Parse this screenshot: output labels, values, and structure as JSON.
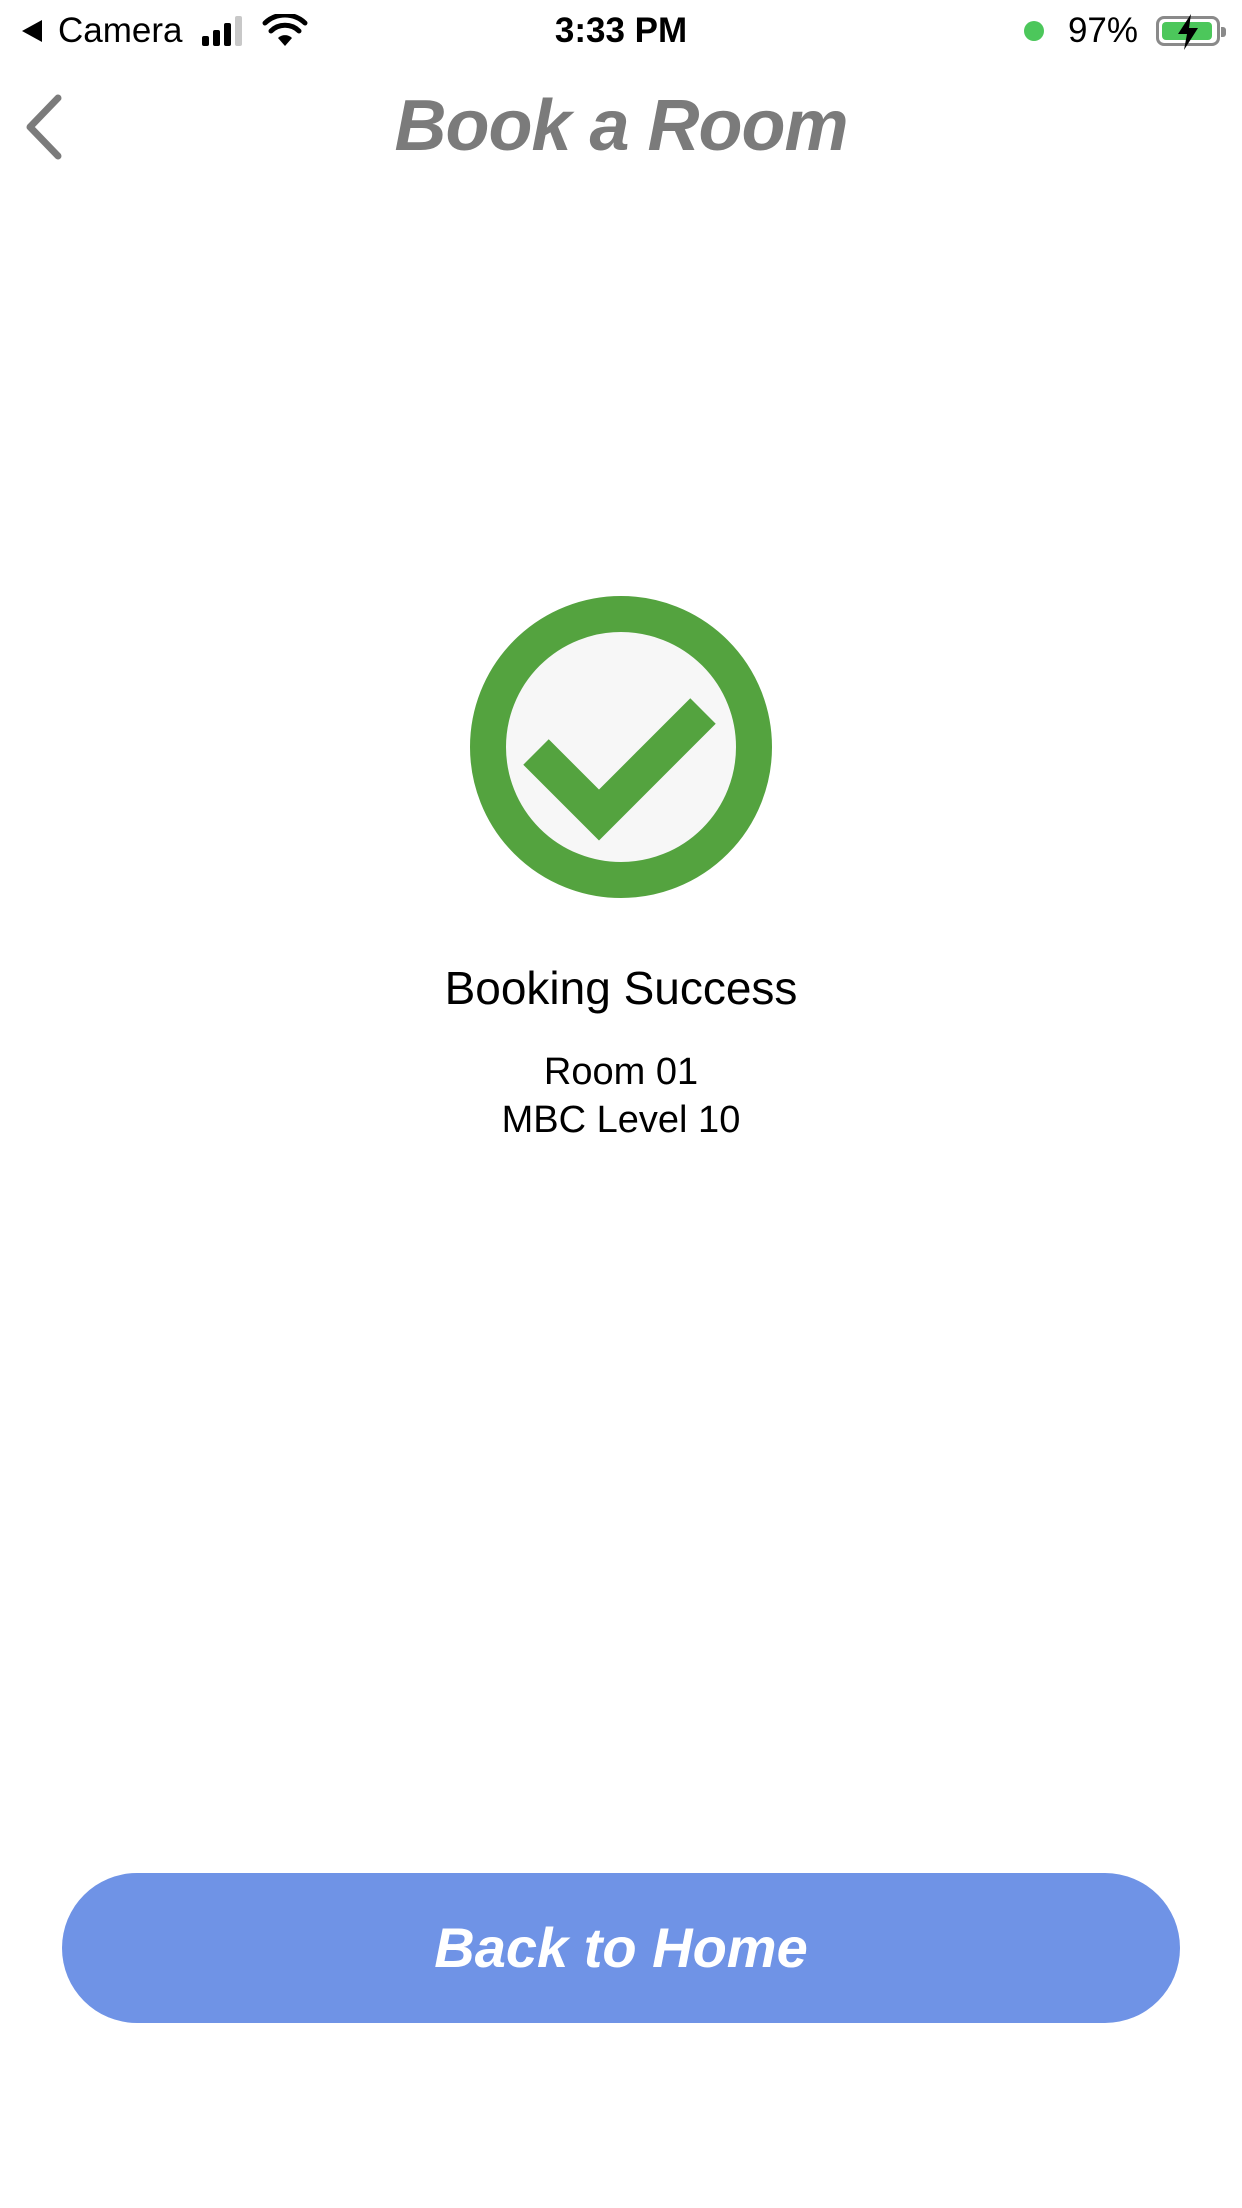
{
  "status_bar": {
    "back_app_label": "Camera",
    "time": "3:33 PM",
    "battery_percent": "97%",
    "battery_level": 0.97,
    "charging": true
  },
  "nav": {
    "title": "Book a Room",
    "back_icon": "chevron-left-icon"
  },
  "result": {
    "icon": "check-circle-icon",
    "title": "Booking Success",
    "room_name": "Room 01",
    "room_location": "MBC Level 10"
  },
  "actions": {
    "home_button_label": "Back to Home"
  },
  "colors": {
    "success_green": "#54a33f",
    "icon_inner_bg": "#f7f7f7",
    "button_blue": "#6f93e6",
    "title_gray": "#7b7b7b",
    "status_green": "#4cc75b"
  }
}
